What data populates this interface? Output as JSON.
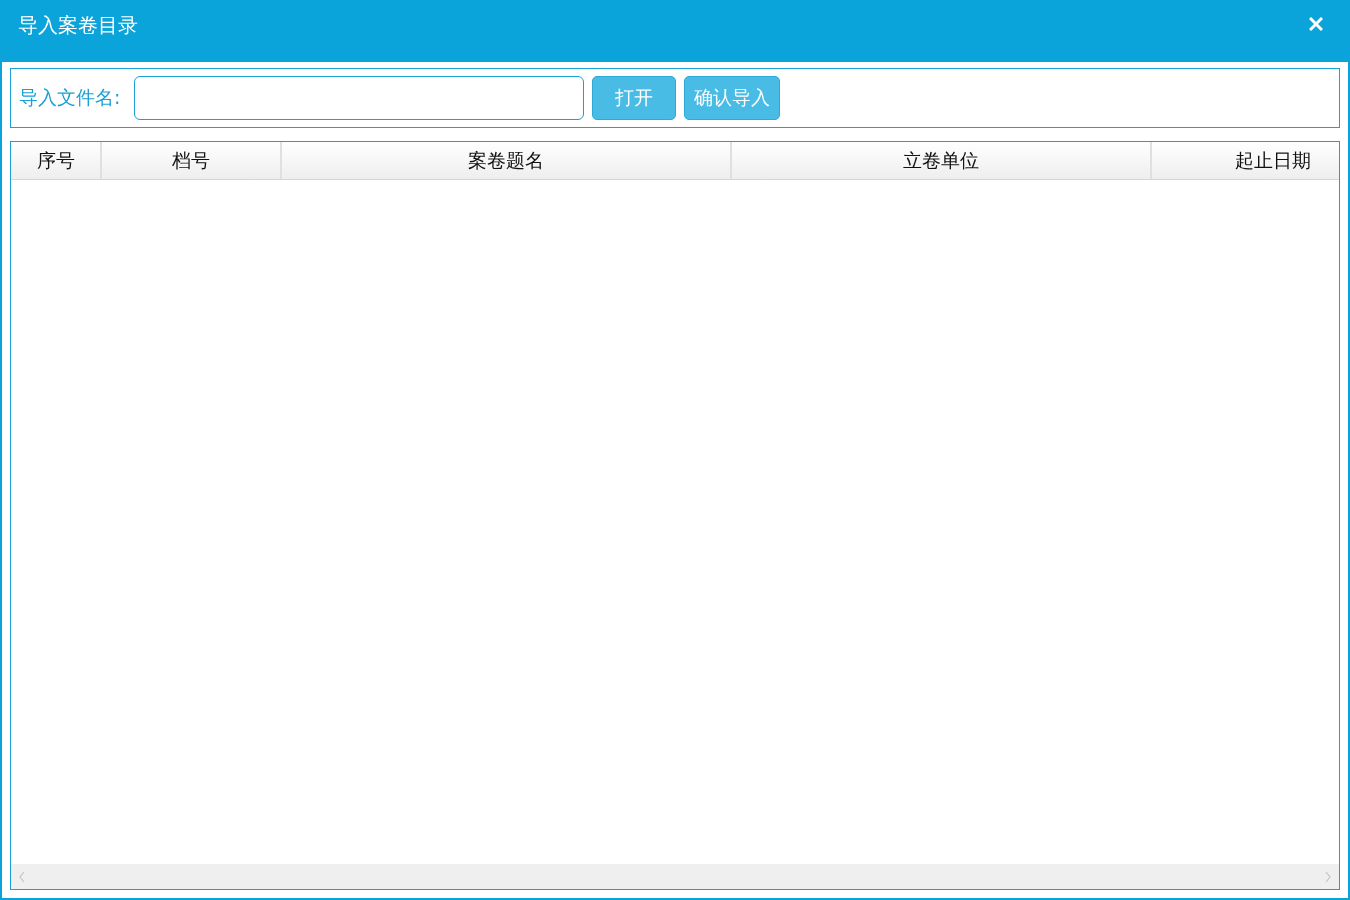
{
  "window": {
    "title": "导入案卷目录"
  },
  "toolbar": {
    "label": "导入文件名:",
    "buttons": [
      "打开",
      "确认导入"
    ]
  },
  "table": {
    "columns": [
      "序号",
      "档号",
      "案卷题名",
      "立卷单位",
      "起止日期"
    ]
  }
}
